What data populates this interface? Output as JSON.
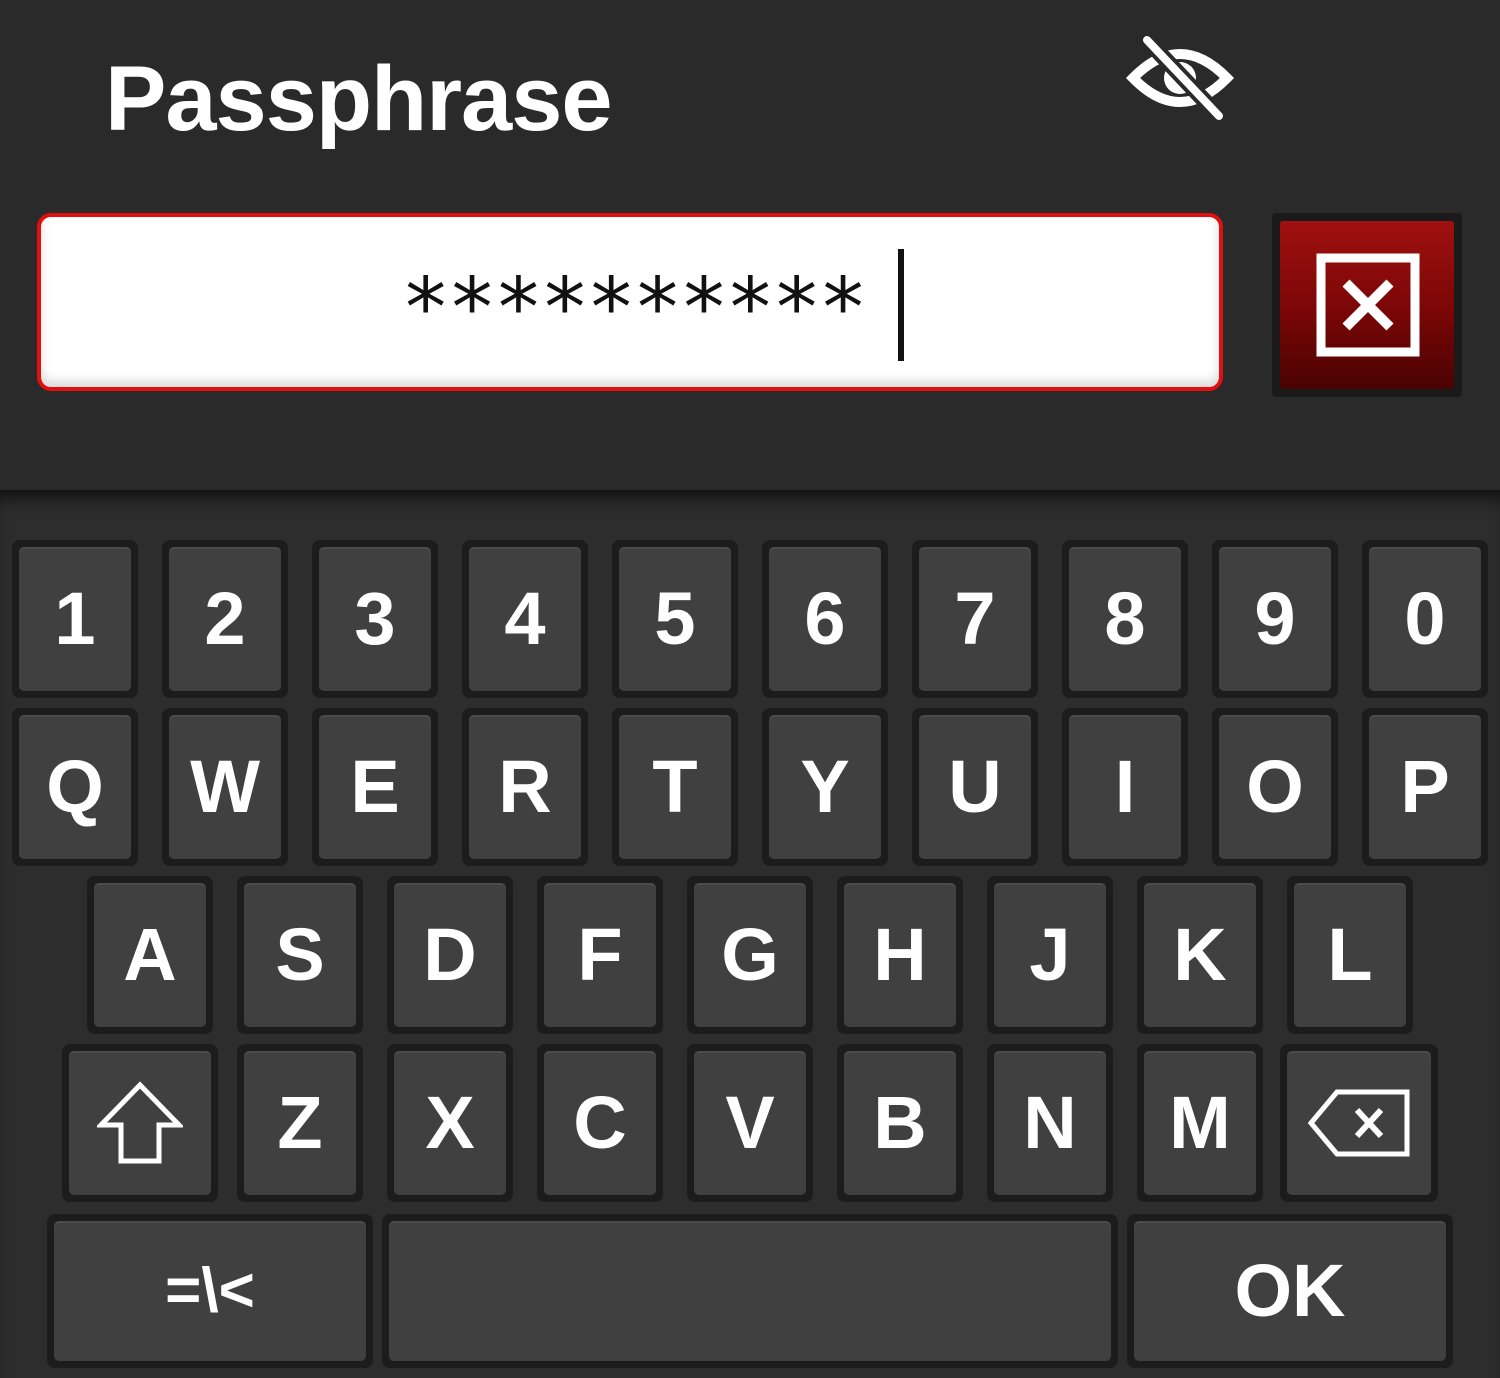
{
  "header": {
    "title": "Passphrase",
    "visibility_toggle_icon": "eye-slash-icon"
  },
  "password_field": {
    "value": "**********",
    "clear_icon": "close-box-icon"
  },
  "keyboard": {
    "row1": [
      "1",
      "2",
      "3",
      "4",
      "5",
      "6",
      "7",
      "8",
      "9",
      "0"
    ],
    "row2": [
      "Q",
      "W",
      "E",
      "R",
      "T",
      "Y",
      "U",
      "I",
      "O",
      "P"
    ],
    "row3": [
      "A",
      "S",
      "D",
      "F",
      "G",
      "H",
      "J",
      "K",
      "L"
    ],
    "row4": [
      "Z",
      "X",
      "C",
      "V",
      "B",
      "N",
      "M"
    ],
    "shift_icon": "shift-up-arrow-icon",
    "backspace_icon": "backspace-icon",
    "symbols_label": "=\\<",
    "space_label": "",
    "ok_label": "OK"
  },
  "colors": {
    "background": "#2a2a2a",
    "key_face": "#404040",
    "field_border": "#e01010",
    "clear_button": "#8a0808"
  }
}
